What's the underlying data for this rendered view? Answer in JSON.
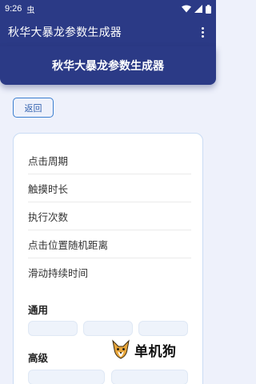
{
  "status_bar": {
    "time": "9:26",
    "notification_glyph": "虫"
  },
  "app_bar": {
    "title": "秋华大暴龙参数生成器",
    "overflow_icon": "more-vert-icon"
  },
  "banner": {
    "title": "秋华大暴龙参数生成器"
  },
  "back_button": {
    "label": "返回"
  },
  "settings": {
    "items": [
      {
        "label": "点击周期"
      },
      {
        "label": "触摸时长"
      },
      {
        "label": "执行次数"
      },
      {
        "label": "点击位置随机距离"
      },
      {
        "label": "滑动持续时间"
      }
    ]
  },
  "sections": {
    "general": {
      "label": "通用"
    },
    "advanced": {
      "label": "高级"
    }
  },
  "watermark": {
    "text": "单机狗",
    "logo_icon": "fox-logo-icon"
  },
  "colors": {
    "primary": "#2b3a86",
    "accent": "#3b7fd0",
    "background": "#eef1fb"
  }
}
